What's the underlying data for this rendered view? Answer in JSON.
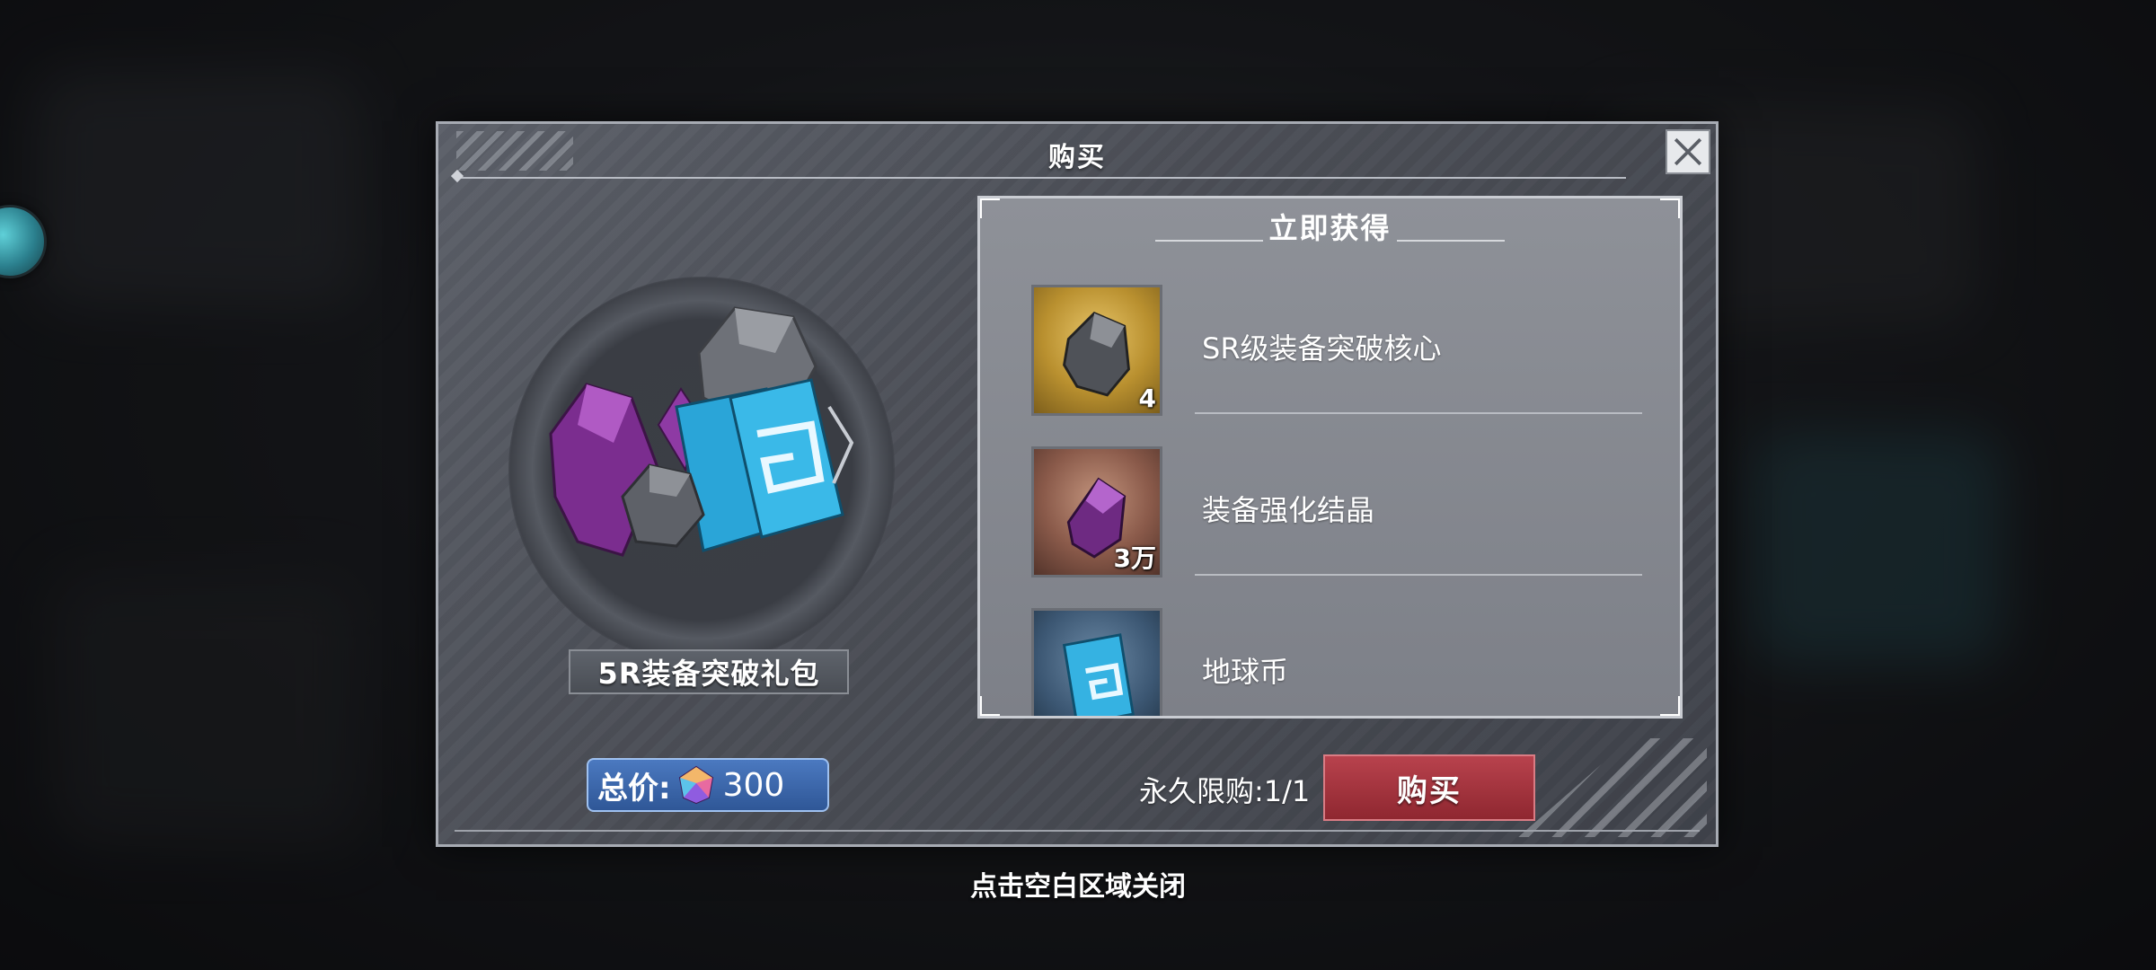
{
  "dialog": {
    "title": "购买",
    "close_icon": "close-icon"
  },
  "package": {
    "name": "5R装备突破礼包"
  },
  "price": {
    "label": "总价:",
    "currency_icon": "gem-icon",
    "value": "300"
  },
  "rewards": {
    "title": "立即获得",
    "items": [
      {
        "name": "SR级装备突破核心",
        "quantity": "4",
        "icon": "ore-icon"
      },
      {
        "name": "装备强化结晶",
        "quantity": "3万",
        "icon": "crystal-icon"
      },
      {
        "name": "地球币",
        "quantity": "",
        "icon": "ticket-icon"
      }
    ]
  },
  "footer": {
    "limit_text": "永久限购:1/1",
    "buy_label": "购买"
  },
  "hint": {
    "tap_outside": "点击空白区域关闭"
  },
  "colors": {
    "buy_button": "#a8333d",
    "price_box": "#3d68ad",
    "dialog_bg": "#4b4e56"
  }
}
